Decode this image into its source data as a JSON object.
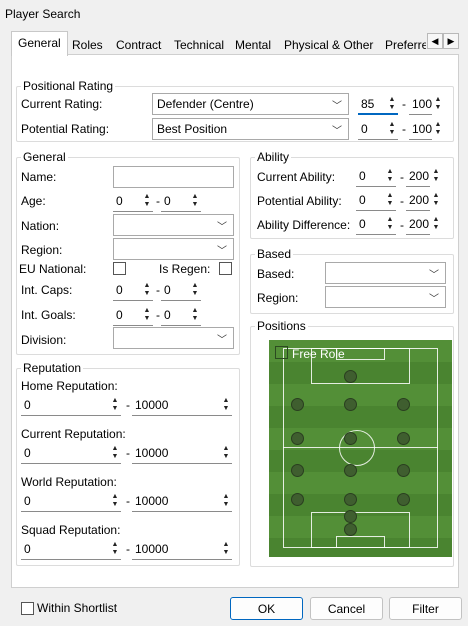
{
  "window": {
    "title": "Player Search"
  },
  "tabs": [
    "General",
    "Roles",
    "Contract",
    "Technical",
    "Mental",
    "Physical & Other",
    "Preferre"
  ],
  "positional": {
    "legend": "Positional Rating",
    "current_label": "Current Rating:",
    "current_value": "Defender (Centre)",
    "current_min": "85",
    "current_max": "100",
    "potential_label": "Potential Rating:",
    "potential_value": "Best Position",
    "potential_min": "0",
    "potential_max": "100"
  },
  "general": {
    "legend": "General",
    "name_label": "Name:",
    "age_label": "Age:",
    "age_min": "0",
    "age_max": "0",
    "nation_label": "Nation:",
    "region_label": "Region:",
    "eu_label": "EU National:",
    "regen_label": "Is Regen:",
    "caps_label": "Int. Caps:",
    "caps_min": "0",
    "caps_max": "0",
    "goals_label": "Int. Goals:",
    "goals_min": "0",
    "goals_max": "0",
    "division_label": "Division:"
  },
  "ability": {
    "legend": "Ability",
    "current_label": "Current Ability:",
    "current_min": "0",
    "current_max": "200",
    "potential_label": "Potential Ability:",
    "potential_min": "0",
    "potential_max": "200",
    "diff_label": "Ability Difference:",
    "diff_min": "0",
    "diff_max": "200"
  },
  "based": {
    "legend": "Based",
    "based_label": "Based:",
    "region_label": "Region:"
  },
  "positions": {
    "legend": "Positions",
    "free_role_label": "Free Role"
  },
  "reputation": {
    "legend": "Reputation",
    "home_label": "Home Reputation:",
    "current_label": "Current Reputation:",
    "world_label": "World Reputation:",
    "squad_label": "Squad Reputation:",
    "min": "0",
    "max": "10000"
  },
  "footer": {
    "shortlist_label": "Within Shortlist",
    "ok": "OK",
    "cancel": "Cancel",
    "filter": "Filter"
  }
}
